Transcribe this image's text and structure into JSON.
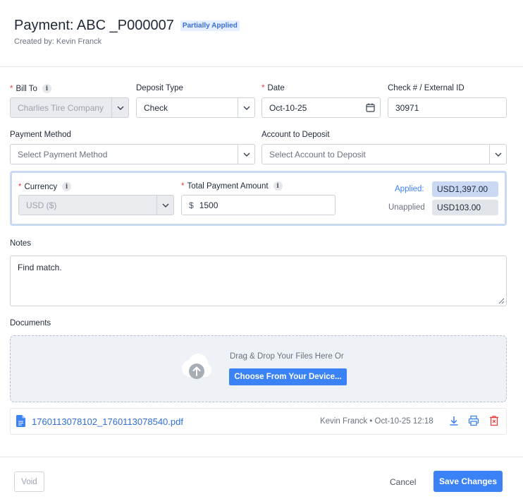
{
  "header": {
    "title": "Payment: ABC _P000007",
    "status_badge": "Partially Applied",
    "created_by": "Created by: Kevin Franck"
  },
  "form": {
    "bill_to": {
      "label": "Bill To",
      "value": "Charlies Tire Company",
      "required": true,
      "disabled": true
    },
    "deposit_type": {
      "label": "Deposit Type",
      "value": "Check"
    },
    "date": {
      "label": "Date",
      "value": "Oct-10-25",
      "required": true
    },
    "check_number": {
      "label": "Check # / External ID",
      "value": "30971"
    },
    "payment_method": {
      "label": "Payment Method",
      "placeholder": "Select Payment Method"
    },
    "account_to_deposit": {
      "label": "Account to Deposit",
      "placeholder": "Select Account to Deposit"
    },
    "currency": {
      "label": "Currency",
      "value": "USD ($)",
      "required": true,
      "disabled": true
    },
    "total_payment": {
      "label": "Total Payment Amount",
      "prefix": "$",
      "value": "1500",
      "required": true
    },
    "applied": {
      "label": "Applied:",
      "value": "USD1,397.00"
    },
    "unapplied": {
      "label": "Unapplied",
      "value": "USD103.00"
    },
    "notes": {
      "label": "Notes",
      "value": "Find match."
    }
  },
  "documents": {
    "label": "Documents",
    "drop_text": "Drag & Drop Your Files Here Or",
    "choose_label": "Choose From Your Device...",
    "files": [
      {
        "name": "1760113078102_1760113078540.pdf",
        "meta": "Kevin Franck • Oct-10-25 12:18"
      }
    ]
  },
  "footer": {
    "void_label": "Void",
    "cancel_label": "Cancel",
    "save_label": "Save Changes"
  },
  "colors": {
    "accent": "#3b82f6",
    "required": "#e53e3e",
    "delete": "#e53e3e",
    "applied_pill": "#c9d8f3",
    "unapplied_pill": "#e1e5ea"
  },
  "icons": [
    "info-icon",
    "chevron-down-icon",
    "calendar-icon",
    "cloud-upload-icon",
    "file-icon",
    "download-icon",
    "print-icon",
    "delete-icon",
    "resize-grip-icon"
  ]
}
